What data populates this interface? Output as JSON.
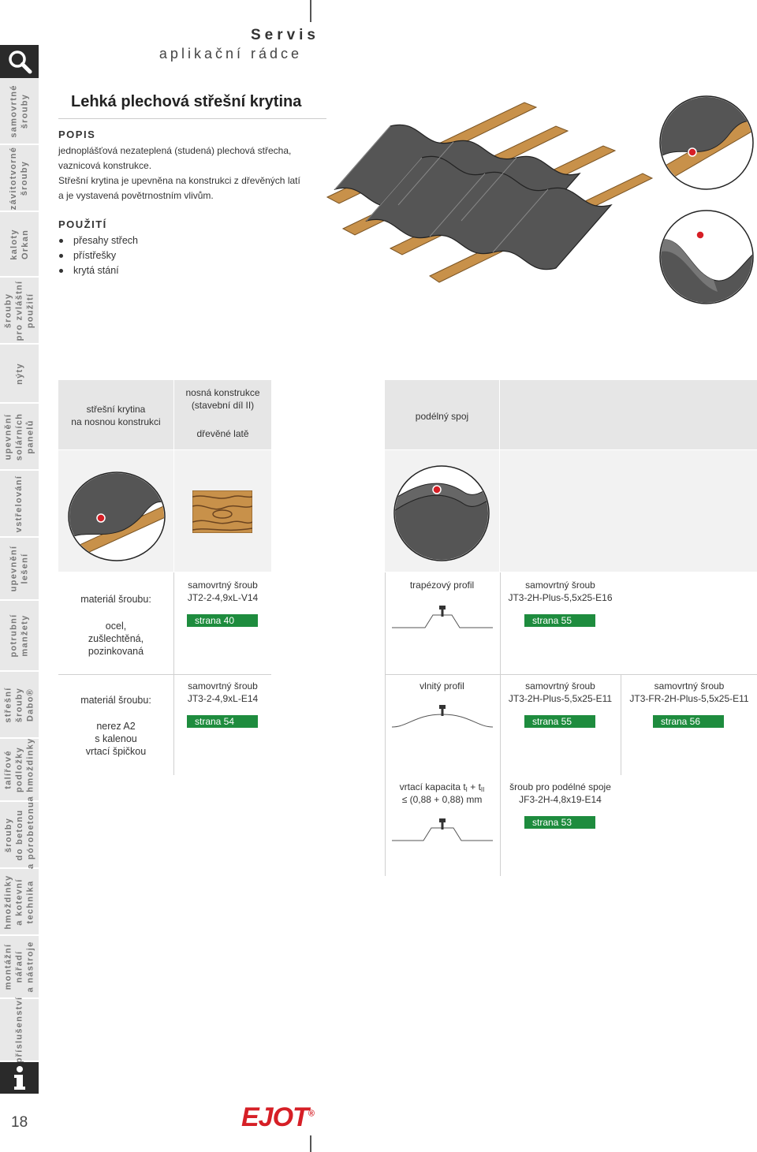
{
  "header": {
    "title": "Servis",
    "subtitle": "aplikační rádce"
  },
  "sidebar": {
    "items": [
      {
        "label": "samovrtné\nšrouby"
      },
      {
        "label": "závitotvorné\nšrouby"
      },
      {
        "label": "kaloty\nOrkan"
      },
      {
        "label": "šrouby\npro zvláštní\npoužití"
      },
      {
        "label": "nýty"
      },
      {
        "label": "upevnění\nsolárních\npanelů"
      },
      {
        "label": "vstřelování"
      },
      {
        "label": "upevnění\nlešení"
      },
      {
        "label": "potrubní\nmanžety"
      },
      {
        "label": "střešní\nšrouby\nDabo®"
      },
      {
        "label": "talířové\npodložky\na hmoždinky"
      },
      {
        "label": "šrouby\ndo betonu\na pórobetonu"
      },
      {
        "label": "hmoždinky\na kotevní\ntechnika"
      },
      {
        "label": "montážní\nnářadí\na nástroje"
      },
      {
        "label": "příslušenství"
      }
    ]
  },
  "page_number": "18",
  "main": {
    "title": "Lehká plechová střešní krytina",
    "popis_heading": "POPIS",
    "popis_lines": [
      "jednoplášťová nezateplená (studená) plechová střecha,",
      "vaznicová konstrukce.",
      "Střešní krytina je upevněna na konstrukci z dřevěných latí",
      "a je vystavená povětrnostním vlivům."
    ],
    "pouziti_heading": "POUŽITÍ",
    "pouziti_items": [
      "přesahy střech",
      "přístřešky",
      "krytá stání"
    ]
  },
  "table": {
    "head_col1": "střešní krytina\nna nosnou konstrukci",
    "head_col2a": "nosná konstrukce\n(stavební díl II)",
    "head_col2b": "dřevěné latě",
    "head_col3": "podélný spoj",
    "row1": {
      "material_label": "materiál šroubu:",
      "material_value": "ocel,\nzušlechtěná,\npozinkovaná",
      "screw_type": "samovrtný šroub",
      "screw_code": "JT2-2-4,9xL-V14",
      "page": "strana 40",
      "profile": "trapézový profil",
      "screw2_type": "samovrtný šroub",
      "screw2_code": "JT3-2H-Plus-5,5x25-E16",
      "page2": "strana 55"
    },
    "row2": {
      "material_label": "materiál šroubu:",
      "material_value": "nerez A2\ns kalenou\nvrtací špičkou",
      "screw_type": "samovrtný šroub",
      "screw_code": "JT3-2-4,9xL-E14",
      "page": "strana 54",
      "profile": "vlnitý profil",
      "screw2_type": "samovrtný šroub",
      "screw2_code": "JT3-2H-Plus-5,5x25-E11",
      "page2": "strana 55",
      "screw3_type": "samovrtný šroub",
      "screw3_code": "JT3-FR-2H-Plus-5,5x25-E11",
      "page3": "strana 56"
    },
    "row3": {
      "capacity_label": "vrtací kapacita t",
      "capacity_values": "≤ (0,88 + 0,88) mm",
      "seam_type": "šroub pro podélné spoje",
      "seam_code": "JF3-2H-4,8x19-E14",
      "page": "strana 53"
    }
  },
  "logo": "EJOT",
  "colors": {
    "badge_green": "#1e8c3e",
    "logo_red": "#d61f26",
    "sidebar_bg": "#e8e8e8",
    "dark": "#2a2a2a"
  }
}
